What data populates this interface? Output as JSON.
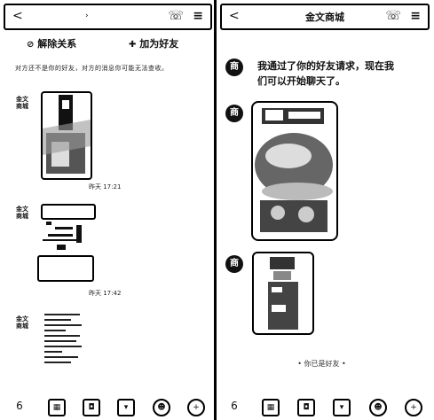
{
  "left": {
    "topbar": {
      "back_icon": "<",
      "mid_icon": "›",
      "call_icon": "☏",
      "menu_icon": "≡"
    },
    "unfriend_label": "解除关系",
    "add_friend_label": "加为好友",
    "notice": "对方还不是你的好友，对方的消息你可能无法查收。",
    "messages": [
      {
        "avatar": "金文\n商城",
        "type": "product-photo",
        "time": "昨天 17:21"
      },
      {
        "avatar": "金文\n商城",
        "type": "product-box",
        "time": "昨天 17:42"
      },
      {
        "avatar": "金文\n商城",
        "type": "document"
      }
    ],
    "bottom_icons": [
      "voice-icon",
      "image-icon",
      "camera-icon",
      "gift-icon",
      "emoji-icon",
      "more-icon"
    ]
  },
  "right": {
    "topbar": {
      "back_icon": "<",
      "title": "金文商城",
      "call_icon": "☏",
      "menu_icon": "≡"
    },
    "messages": [
      {
        "avatar": "商",
        "text": "我通过了你的好友请求，现在我们可以开始聊天了。"
      },
      {
        "avatar": "商",
        "type": "product-photo-large"
      },
      {
        "avatar": "商",
        "type": "product-photo-small"
      }
    ],
    "system_notice": "• 你已是好友 •",
    "bottom_icons": [
      "voice-icon",
      "image-icon",
      "camera-icon",
      "gift-icon",
      "emoji-icon",
      "more-icon"
    ]
  }
}
